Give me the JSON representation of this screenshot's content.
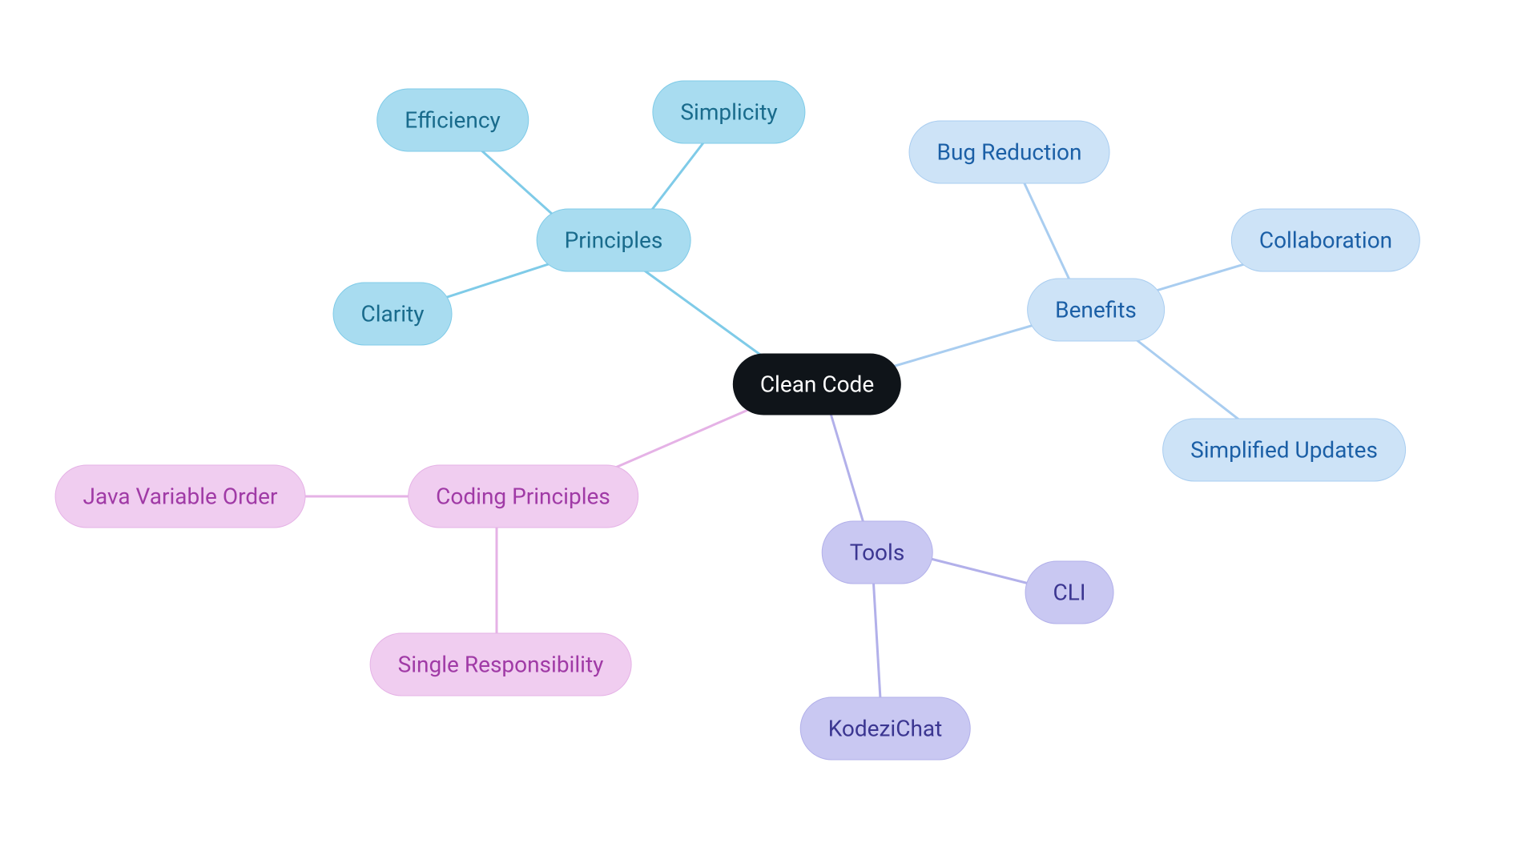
{
  "root": {
    "label": "Clean Code"
  },
  "principles": {
    "label": "Principles",
    "children": {
      "efficiency": "Efficiency",
      "simplicity": "Simplicity",
      "clarity": "Clarity"
    }
  },
  "benefits": {
    "label": "Benefits",
    "children": {
      "bug_reduction": "Bug Reduction",
      "collaboration": "Collaboration",
      "simplified_updates": "Simplified Updates"
    }
  },
  "tools": {
    "label": "Tools",
    "children": {
      "cli": "CLI",
      "kodezichat": "KodeziChat"
    }
  },
  "coding_principles": {
    "label": "Coding Principles",
    "children": {
      "java_variable_order": "Java Variable Order",
      "single_responsibility": "Single Responsibility"
    }
  },
  "colors": {
    "cyan_stroke": "#7fcbe8",
    "blue_stroke": "#a9cdf0",
    "purple_stroke": "#b2b0ea",
    "pink_stroke": "#e5b2e6"
  }
}
